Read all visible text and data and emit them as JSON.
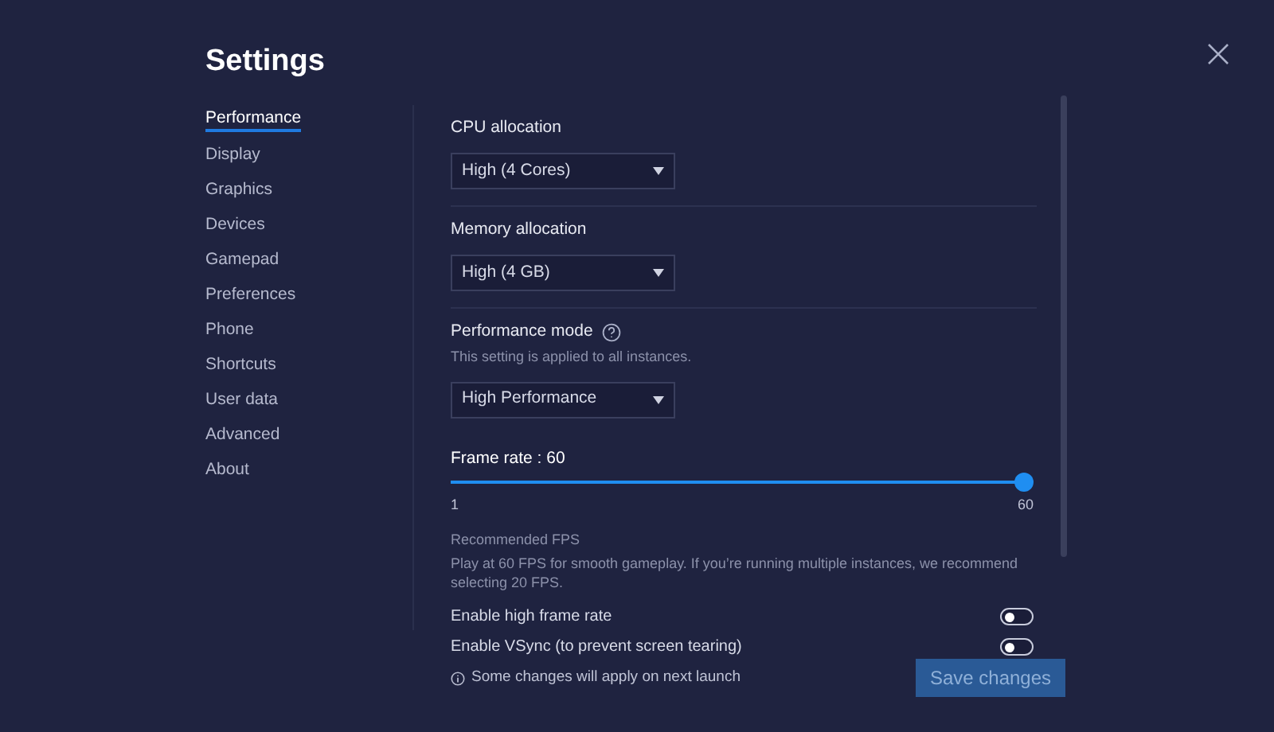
{
  "title": "Settings",
  "sidebar": {
    "items": [
      {
        "label": "Performance",
        "selected": true
      },
      {
        "label": "Display",
        "selected": false
      },
      {
        "label": "Graphics",
        "selected": false
      },
      {
        "label": "Devices",
        "selected": false
      },
      {
        "label": "Gamepad",
        "selected": false
      },
      {
        "label": "Preferences",
        "selected": false
      },
      {
        "label": "Phone",
        "selected": false
      },
      {
        "label": "Shortcuts",
        "selected": false
      },
      {
        "label": "User data",
        "selected": false
      },
      {
        "label": "Advanced",
        "selected": false
      },
      {
        "label": "About",
        "selected": false
      }
    ]
  },
  "sections": [
    {
      "kind": "dropdown",
      "label": "CPU allocation",
      "value": "High (4 Cores)"
    },
    {
      "kind": "dropdown",
      "label": "Memory allocation",
      "value": "High (4 GB)"
    },
    {
      "kind": "dropdown",
      "label": "Performance mode",
      "help": true,
      "hint": "This setting is applied to all instances.",
      "value": "High Performance"
    }
  ],
  "frame_rate": {
    "label": "Frame rate : 60",
    "level": 1,
    "min": "1",
    "max": "60",
    "note_title": "Recommended FPS",
    "note": "Play at 60 FPS for smooth gameplay. If you’re running multiple instances, we recommend selecting 20 FPS."
  },
  "toggles": [
    {
      "label": "Enable high frame rate",
      "on": false
    },
    {
      "label": "Enable VSync (to prevent screen tearing)",
      "on": false
    }
  ],
  "footer": {
    "notice": "Some changes will apply on next launch",
    "button": "Save changes"
  }
}
